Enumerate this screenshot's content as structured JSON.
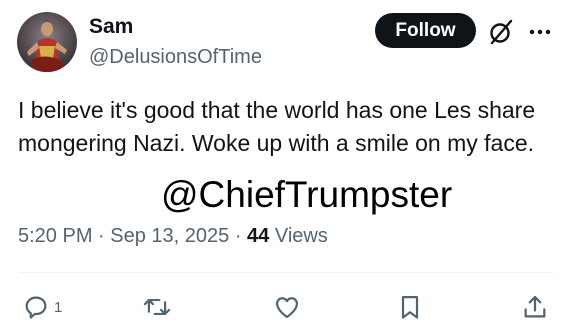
{
  "user": {
    "display_name": "Sam",
    "handle": "@DelusionsOfTime"
  },
  "header": {
    "follow_label": "Follow",
    "grok_icon": "grok-slash-icon",
    "more_icon": "more-dots-icon"
  },
  "tweet": {
    "text": "I believe it's good that the world has one Les share mongering Nazi. Woke up with a smile on my face."
  },
  "watermark": {
    "text": "@ChiefTrumpster"
  },
  "meta": {
    "time": "5:20 PM",
    "separator": " · ",
    "date": "Sep 13, 2025",
    "views_count": "44",
    "views_label": " Views"
  },
  "actions": {
    "reply_count": "1",
    "reply_icon": "reply-icon",
    "repost_icon": "repost-icon",
    "like_icon": "heart-icon",
    "bookmark_icon": "bookmark-icon",
    "share_icon": "share-icon"
  },
  "colors": {
    "text_primary": "#0f1419",
    "text_secondary": "#536471",
    "follow_bg": "#0f1419",
    "divider": "#eff3f4"
  }
}
